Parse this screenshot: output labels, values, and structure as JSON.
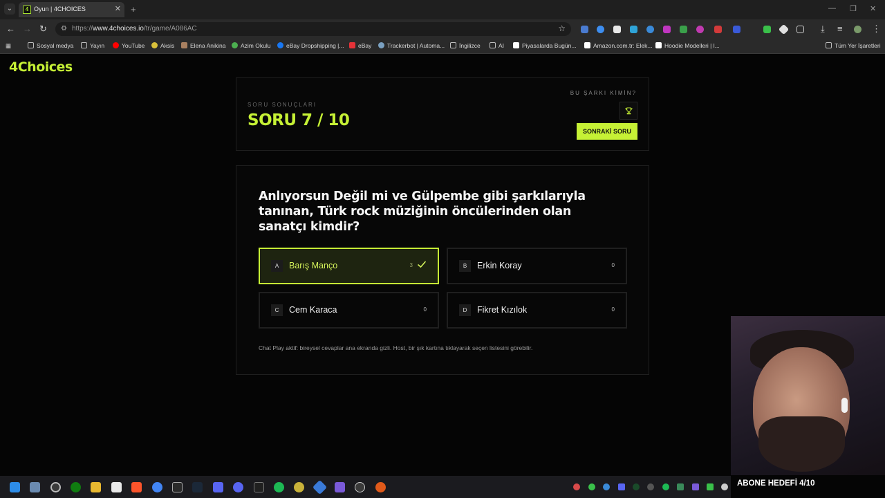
{
  "browser": {
    "tab_title": "Oyun | 4CHOICES",
    "favicon_letter": "4",
    "url_prefix": "https://",
    "url_host": "www.4choices.io",
    "url_path": "/tr/game/A086AC",
    "bookmarks": [
      {
        "label": "Sosyal medya",
        "icon": "folder-icon",
        "color": "#bdbdbd"
      },
      {
        "label": "Yayın",
        "icon": "folder-icon",
        "color": "#bdbdbd"
      },
      {
        "label": "YouTube",
        "icon": "youtube-icon",
        "color": "#ff0000"
      },
      {
        "label": "Aksis",
        "icon": "aksis-icon",
        "color": "#d8c03a"
      },
      {
        "label": "Elena Anikina",
        "icon": "photo-icon",
        "color": "#a88060"
      },
      {
        "label": "Azim Okulu",
        "icon": "azim-icon",
        "color": "#4caf50"
      },
      {
        "label": "eBay Dropshipping |...",
        "icon": "facebook-icon",
        "color": "#1877f2"
      },
      {
        "label": "eBay",
        "icon": "ebay-icon",
        "color": "#e53238"
      },
      {
        "label": "Trackerbot | Automa...",
        "icon": "trackerbot-icon",
        "color": "#7aa0c0"
      },
      {
        "label": "İngilizce",
        "icon": "folder-icon",
        "color": "#bdbdbd"
      },
      {
        "label": "AI",
        "icon": "folder-icon",
        "color": "#bdbdbd"
      },
      {
        "label": "Piyasalarda Bugün...",
        "icon": "tv-icon",
        "color": "#ffffff"
      },
      {
        "label": "Amazon.com.tr: Elek...",
        "icon": "amazon-icon",
        "color": "#ffffff"
      },
      {
        "label": "Hoodie Modelleri | l...",
        "icon": "hoodie-icon",
        "color": "#ffffff"
      }
    ],
    "all_bookmarks": "Tüm Yer İşaretleri"
  },
  "app": {
    "logo": "4Choices",
    "header": {
      "eyebrow": "SORU SONUÇLARI",
      "question_count": "SORU 7 / 10",
      "hint": "BU ŞARKI KİMİN?",
      "next_button": "SONRAKİ SORU"
    },
    "question": "Anlıyorsun Değil mi ve Gülpembe gibi şarkılarıyla tanınan, Türk rock müziğinin öncülerinden olan sanatçı kimdir?",
    "options": [
      {
        "letter": "A",
        "text": "Barış Manço",
        "count": "3",
        "correct": true
      },
      {
        "letter": "B",
        "text": "Erkin Koray",
        "count": "0",
        "correct": false
      },
      {
        "letter": "C",
        "text": "Cem Karaca",
        "count": "0",
        "correct": false
      },
      {
        "letter": "D",
        "text": "Fikret Kızılok",
        "count": "0",
        "correct": false
      }
    ],
    "footnote": "Chat Play aktif: bireysel cevaplar ana ekranda gizli. Host, bir şık kartına tıklayarak seçen listesini görebilir."
  },
  "stream": {
    "goal_text": "ABONE HEDEFİ 4/10"
  },
  "colors": {
    "accent": "#c6f135",
    "background": "#050505",
    "card_border": "#1f1f1f"
  }
}
